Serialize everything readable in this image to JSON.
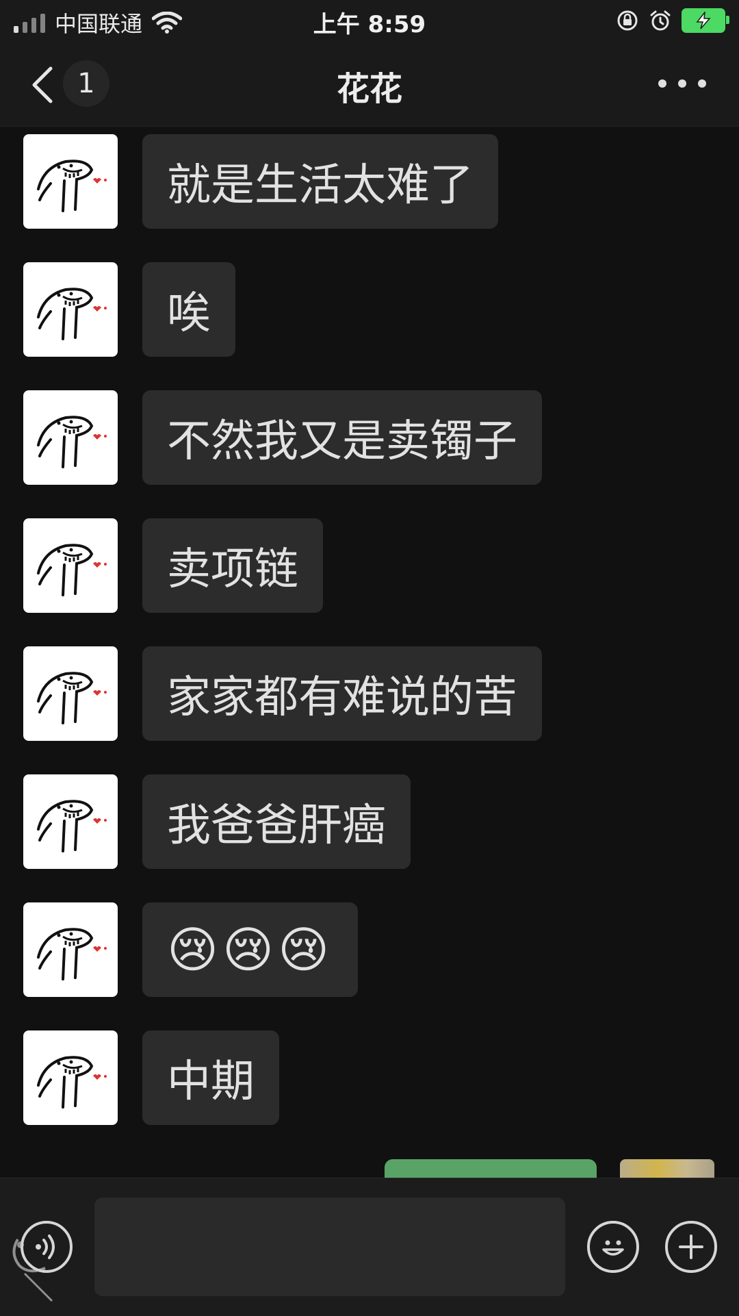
{
  "status_bar": {
    "carrier": "中国联通",
    "time": "上午 8:59",
    "icons": [
      "signal-icon",
      "wifi-icon",
      "rotation-lock-icon",
      "alarm-icon",
      "battery-charging-icon"
    ]
  },
  "nav": {
    "unread_count": "1",
    "title": "花花",
    "icons": [
      "back-chevron-icon",
      "more-dots-icon"
    ]
  },
  "messages": [
    {
      "sender": "contact",
      "text": "就是生活太难了"
    },
    {
      "sender": "contact",
      "text": "唉"
    },
    {
      "sender": "contact",
      "text": "不然我又是卖镯子"
    },
    {
      "sender": "contact",
      "text": "卖项链"
    },
    {
      "sender": "contact",
      "text": "家家都有难说的苦"
    },
    {
      "sender": "contact",
      "text": "我爸爸肝癌"
    },
    {
      "sender": "contact",
      "text": "😢😢😢"
    },
    {
      "sender": "contact",
      "text": "中期"
    }
  ],
  "input_bar": {
    "value": "",
    "icons": [
      "voice-icon",
      "emoji-face-icon",
      "plus-icon"
    ]
  },
  "colors": {
    "background": "#111111",
    "bubble_incoming": "#2c2c2c",
    "bubble_outgoing": "#5aa367",
    "battery": "#4cd964"
  }
}
